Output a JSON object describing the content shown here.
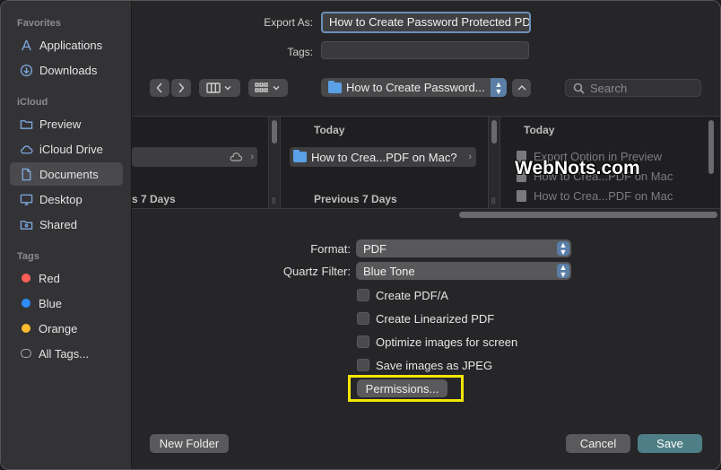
{
  "sidebar": {
    "favorites_header": "Favorites",
    "favorites": [
      {
        "label": "Applications",
        "icon": "applications-icon"
      },
      {
        "label": "Downloads",
        "icon": "downloads-icon"
      }
    ],
    "icloud_header": "iCloud",
    "icloud": [
      {
        "label": "Preview",
        "icon": "folder-icon"
      },
      {
        "label": "iCloud Drive",
        "icon": "cloud-icon"
      },
      {
        "label": "Documents",
        "icon": "document-icon",
        "selected": true
      },
      {
        "label": "Desktop",
        "icon": "desktop-icon"
      },
      {
        "label": "Shared",
        "icon": "shared-folder-icon"
      }
    ],
    "tags_header": "Tags",
    "tags": [
      {
        "label": "Red",
        "color": "#ff5f57"
      },
      {
        "label": "Blue",
        "color": "#2f8cf5"
      },
      {
        "label": "Orange",
        "color": "#febc2e"
      },
      {
        "label": "All Tags..."
      }
    ]
  },
  "export": {
    "export_as_label": "Export As:",
    "export_as_value": "How to Create Password Protected PDF on Mac?",
    "tags_label": "Tags:",
    "tags_value": ""
  },
  "toolbar": {
    "location": "How to Create Password...",
    "search_placeholder": "Search"
  },
  "browser": {
    "col1": {
      "row": "",
      "footer": "s 7 Days"
    },
    "col2": {
      "header": "Today",
      "row": "How to Crea...PDF on Mac?",
      "footer": "Previous 7 Days"
    },
    "col3": {
      "header": "Today",
      "rows": [
        "Export Option in Preview",
        "How to Crea...PDF on Mac",
        "How to Crea...PDF on Mac"
      ]
    },
    "watermark": "WebNots.com"
  },
  "options": {
    "format_label": "Format:",
    "format_value": "PDF",
    "quartz_label": "Quartz Filter:",
    "quartz_value": "Blue Tone",
    "checks": [
      "Create PDF/A",
      "Create Linearized PDF",
      "Optimize images for screen",
      "Save images as JPEG"
    ],
    "permissions_label": "Permissions..."
  },
  "buttons": {
    "new_folder": "New Folder",
    "cancel": "Cancel",
    "save": "Save"
  },
  "colors": {
    "accent": "#4f7f86",
    "highlight": "#f2e600"
  }
}
